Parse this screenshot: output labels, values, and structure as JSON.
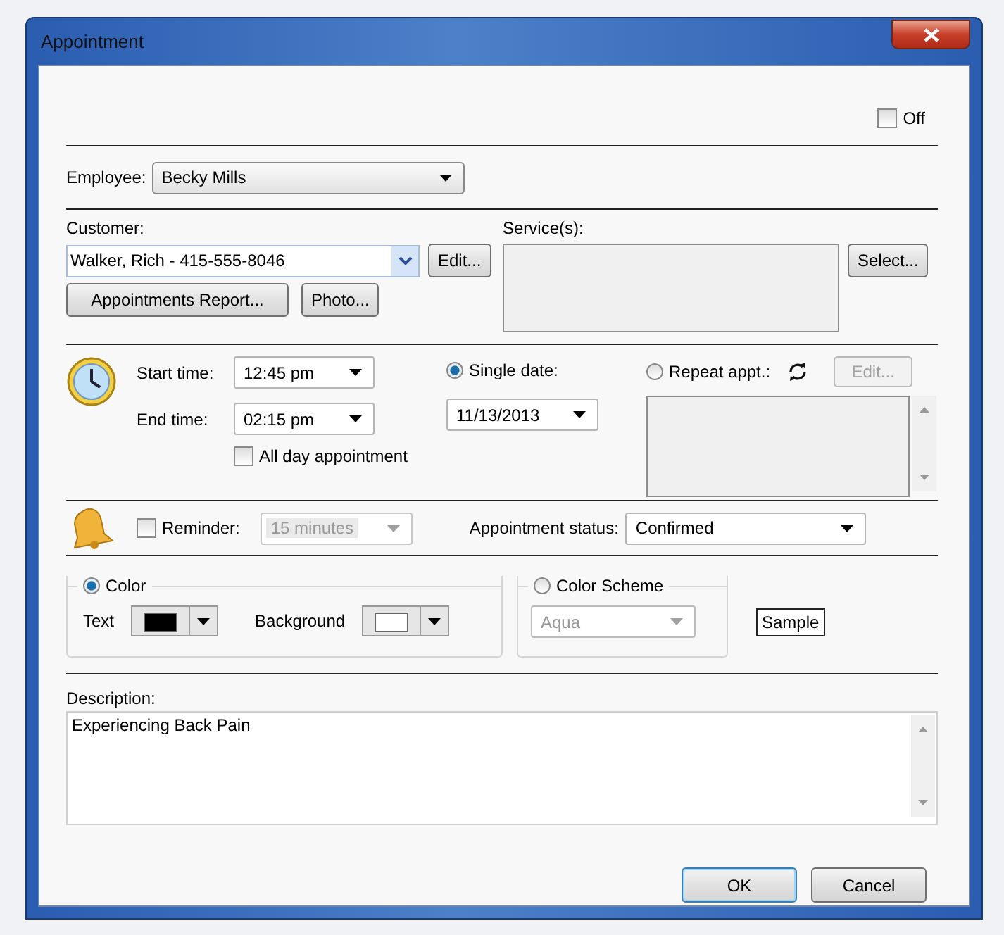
{
  "window": {
    "title": "Appointment"
  },
  "off": {
    "label": "Off",
    "checked": false
  },
  "employee": {
    "label": "Employee:",
    "value": "Becky  Mills"
  },
  "customer": {
    "label": "Customer:",
    "value": "Walker, Rich - 415-555-8046",
    "edit_button": "Edit..."
  },
  "services": {
    "label": "Service(s):",
    "select_button": "Select..."
  },
  "customer_buttons": [
    "Appointments Report...",
    "Photo..."
  ],
  "time": {
    "start_label": "Start time:",
    "start_value": "12:45 pm",
    "end_label": "End time:",
    "end_value": "02:15 pm",
    "all_day": {
      "label": "All day appointment",
      "checked": false
    }
  },
  "date_mode": [
    {
      "label": "Single date:",
      "selected": true
    },
    {
      "label": "Repeat appt.:",
      "selected": false
    }
  ],
  "date_value": "11/13/2013",
  "repeat_edit": {
    "label": "Edit...",
    "disabled": true
  },
  "reminder": {
    "label": "Reminder:",
    "checked": false,
    "value": "15 minutes",
    "disabled": true
  },
  "status": {
    "label": "Appointment status:",
    "value": "Confirmed"
  },
  "color_mode": [
    {
      "label": "Color",
      "selected": true
    },
    {
      "label": "Color Scheme",
      "selected": false
    }
  ],
  "text_color": {
    "label": "Text",
    "color": "#000000"
  },
  "background_color": {
    "label": "Background",
    "color": "#ffffff"
  },
  "scheme": {
    "value": "Aqua",
    "disabled": true
  },
  "sample": "Sample",
  "description": {
    "label": "Description:",
    "value": "Experiencing Back Pain"
  },
  "buttons": [
    {
      "label": "OK",
      "default": true
    },
    {
      "label": "Cancel",
      "default": false
    }
  ]
}
